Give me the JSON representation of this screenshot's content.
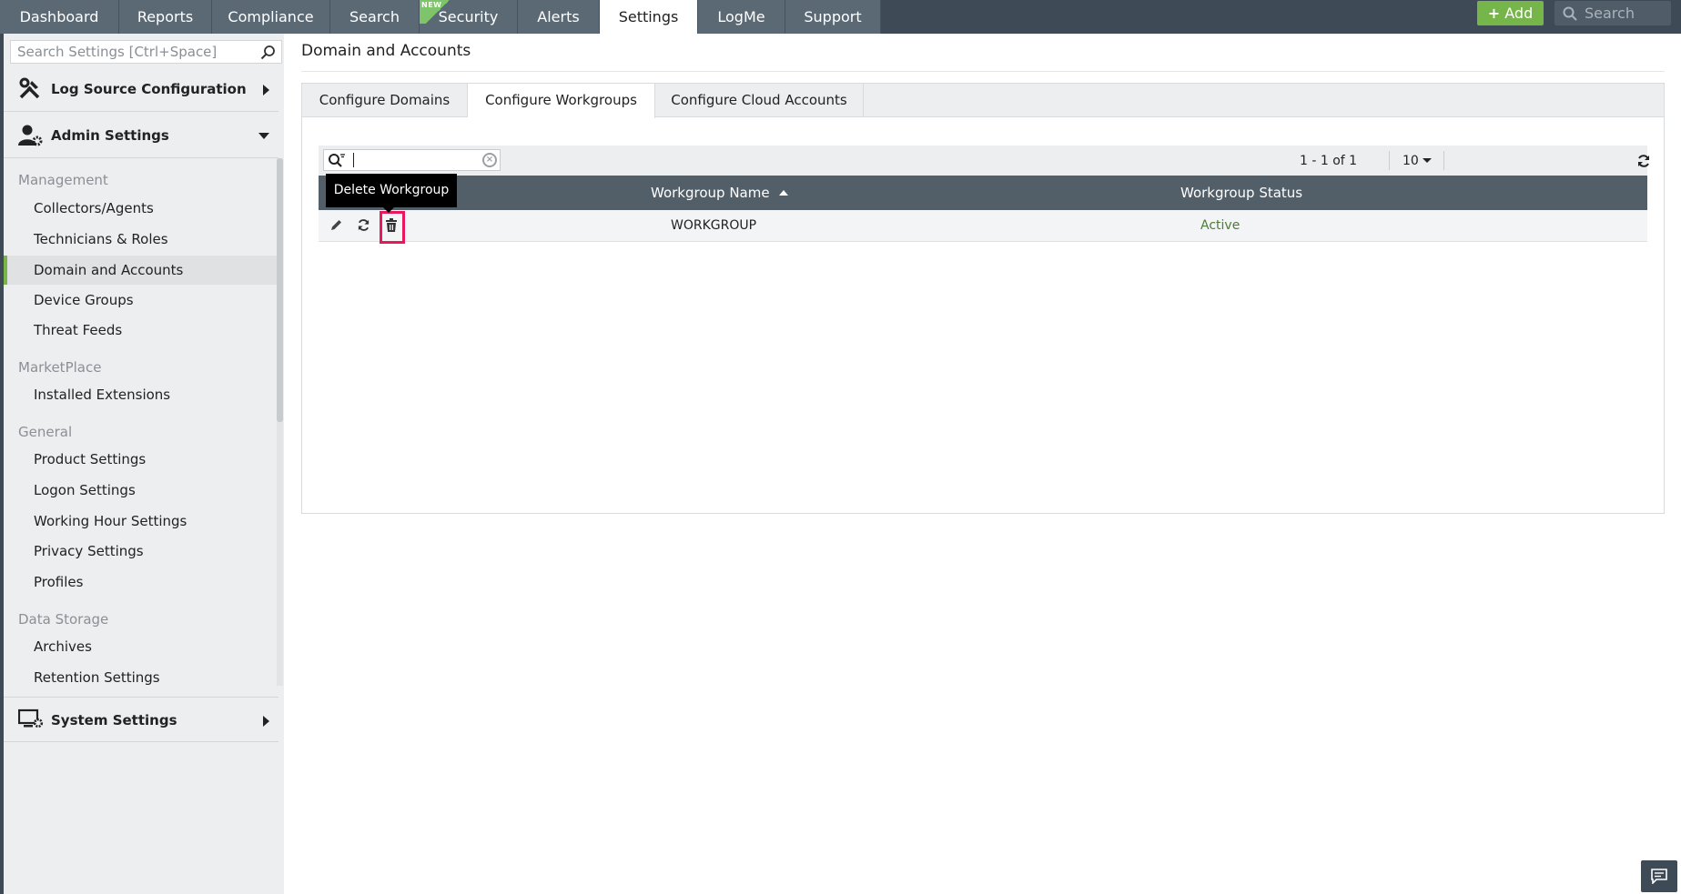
{
  "topnav": {
    "tabs": [
      {
        "label": "Dashboard"
      },
      {
        "label": "Reports"
      },
      {
        "label": "Compliance"
      },
      {
        "label": "Search"
      },
      {
        "label": "Security",
        "badge": "NEW"
      },
      {
        "label": "Alerts"
      },
      {
        "label": "Settings"
      },
      {
        "label": "LogMe"
      },
      {
        "label": "Support"
      }
    ],
    "active_tab": "Settings",
    "add_label": "Add",
    "search_placeholder": "Search"
  },
  "sidebar": {
    "search_placeholder": "Search Settings [Ctrl+Space]",
    "sections": [
      {
        "label": "Log Source Configuration",
        "icon": "tools-icon",
        "expanded": false
      },
      {
        "label": "Admin Settings",
        "icon": "user-gear-icon",
        "expanded": true
      },
      {
        "label": "System Settings",
        "icon": "monitor-gear-icon",
        "expanded": false
      }
    ],
    "groups": [
      {
        "title": "Management",
        "items": [
          "Collectors/Agents",
          "Technicians & Roles",
          "Domain and Accounts",
          "Device Groups",
          "Threat Feeds"
        ]
      },
      {
        "title": "MarketPlace",
        "items": [
          "Installed Extensions"
        ]
      },
      {
        "title": "General",
        "items": [
          "Product Settings",
          "Logon Settings",
          "Working Hour Settings",
          "Privacy Settings",
          "Profiles"
        ]
      },
      {
        "title": "Data Storage",
        "items": [
          "Archives",
          "Retention Settings"
        ]
      }
    ],
    "active_item": "Domain and Accounts"
  },
  "main": {
    "title": "Domain and Accounts",
    "subtabs": [
      {
        "label": "Configure Domains"
      },
      {
        "label": "Configure Workgroups"
      },
      {
        "label": "Configure Cloud Accounts"
      }
    ],
    "active_subtab": "Configure Workgroups",
    "grid": {
      "search_value": "",
      "pagination": "1 - 1 of 1",
      "page_size": "10",
      "columns": [
        "Workgroup Name",
        "Workgroup Status"
      ],
      "sort_column": "Workgroup Name",
      "sort_direction": "asc",
      "rows": [
        {
          "name": "WORKGROUP",
          "status": "Active"
        }
      ],
      "tooltip": "Delete Workgroup"
    }
  },
  "colors": {
    "topbar": "#3e4a55",
    "tab": "#5b6975",
    "accent_green": "#76b54a",
    "status_active": "#4e7a3a",
    "highlight": "#e8185c"
  }
}
